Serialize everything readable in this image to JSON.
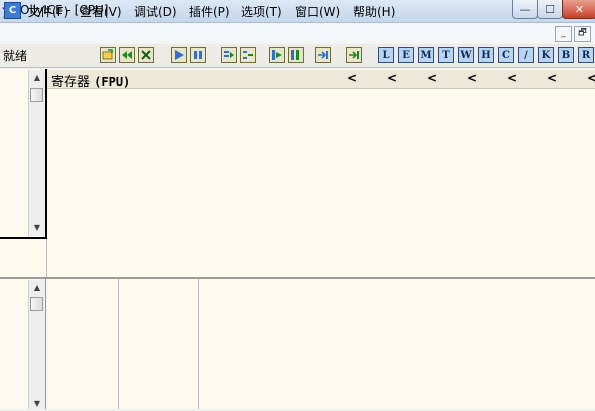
{
  "window": {
    "title": "OllyICE - [CPU]",
    "min_label": "—",
    "max_label": "☐",
    "close_label": "✕"
  },
  "menu": {
    "app_icon_letter": "C",
    "items": [
      "文件(F)",
      "查看(V)",
      "调试(D)",
      "插件(P)",
      "选项(T)",
      "窗口(W)",
      "帮助(H)"
    ],
    "mdi_min": "_",
    "mdi_restore": "🗗"
  },
  "toolbar": {
    "status": "就绪",
    "letters": [
      "L",
      "E",
      "M",
      "T",
      "W",
      "H",
      "C",
      "/",
      "K",
      "B",
      "R"
    ]
  },
  "registers": {
    "title": "寄存器",
    "mode": "(FPU)",
    "arrow": "<"
  },
  "colors": {
    "pane_bg": "#fffaee",
    "toolbar_letter_bg": "#b8d6f2",
    "title_bar": "#c5d7ec"
  }
}
